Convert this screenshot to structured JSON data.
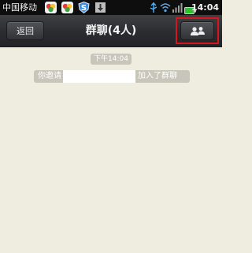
{
  "status_bar": {
    "carrier": "中国移动",
    "time": "14:04",
    "icons": [
      "app-notification-icon",
      "app-notification-icon",
      "security-shield-icon",
      "download-icon",
      "usb-icon",
      "wifi-icon",
      "signal-icon",
      "battery-icon"
    ],
    "shield_letter": "S"
  },
  "title_bar": {
    "back_label": "返回",
    "title": "群聊(4人)",
    "members_icon": "group-members-icon",
    "highlight_color": "#d8141c"
  },
  "chat": {
    "time_label": "下午14:04",
    "system_message": {
      "prefix": "你邀请",
      "suffix": "加入了群聊"
    }
  },
  "colors": {
    "background": "#efeddf",
    "titlebar": "#2a2c30",
    "badge": "#c8c6ba"
  }
}
